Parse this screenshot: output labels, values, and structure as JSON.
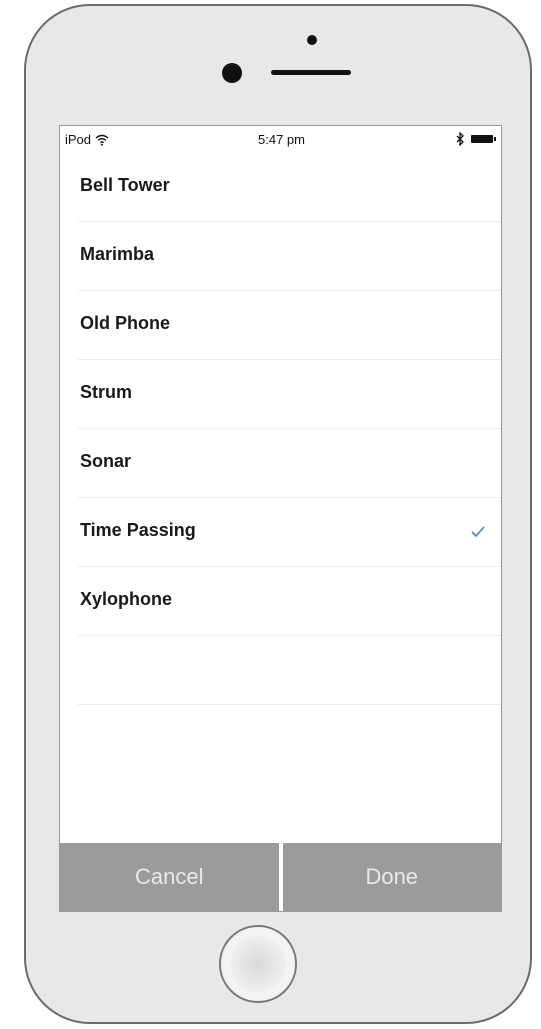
{
  "status_bar": {
    "carrier": "iPod",
    "time": "5:47 pm"
  },
  "list": {
    "items": [
      {
        "label": "Bell Tower",
        "selected": false
      },
      {
        "label": "Marimba",
        "selected": false
      },
      {
        "label": "Old Phone",
        "selected": false
      },
      {
        "label": "Strum",
        "selected": false
      },
      {
        "label": "Sonar",
        "selected": false
      },
      {
        "label": "Time Passing",
        "selected": true
      },
      {
        "label": "Xylophone",
        "selected": false
      }
    ]
  },
  "buttons": {
    "cancel_label": "Cancel",
    "done_label": "Done"
  },
  "colors": {
    "checkmark": "#4a7fd0",
    "button_background": "#9b9b9b",
    "button_text": "#e9e9e9"
  },
  "icons": {
    "wifi": "wifi-icon",
    "bluetooth": "bluetooth-icon",
    "battery": "battery-icon",
    "check": "checkmark-icon"
  }
}
